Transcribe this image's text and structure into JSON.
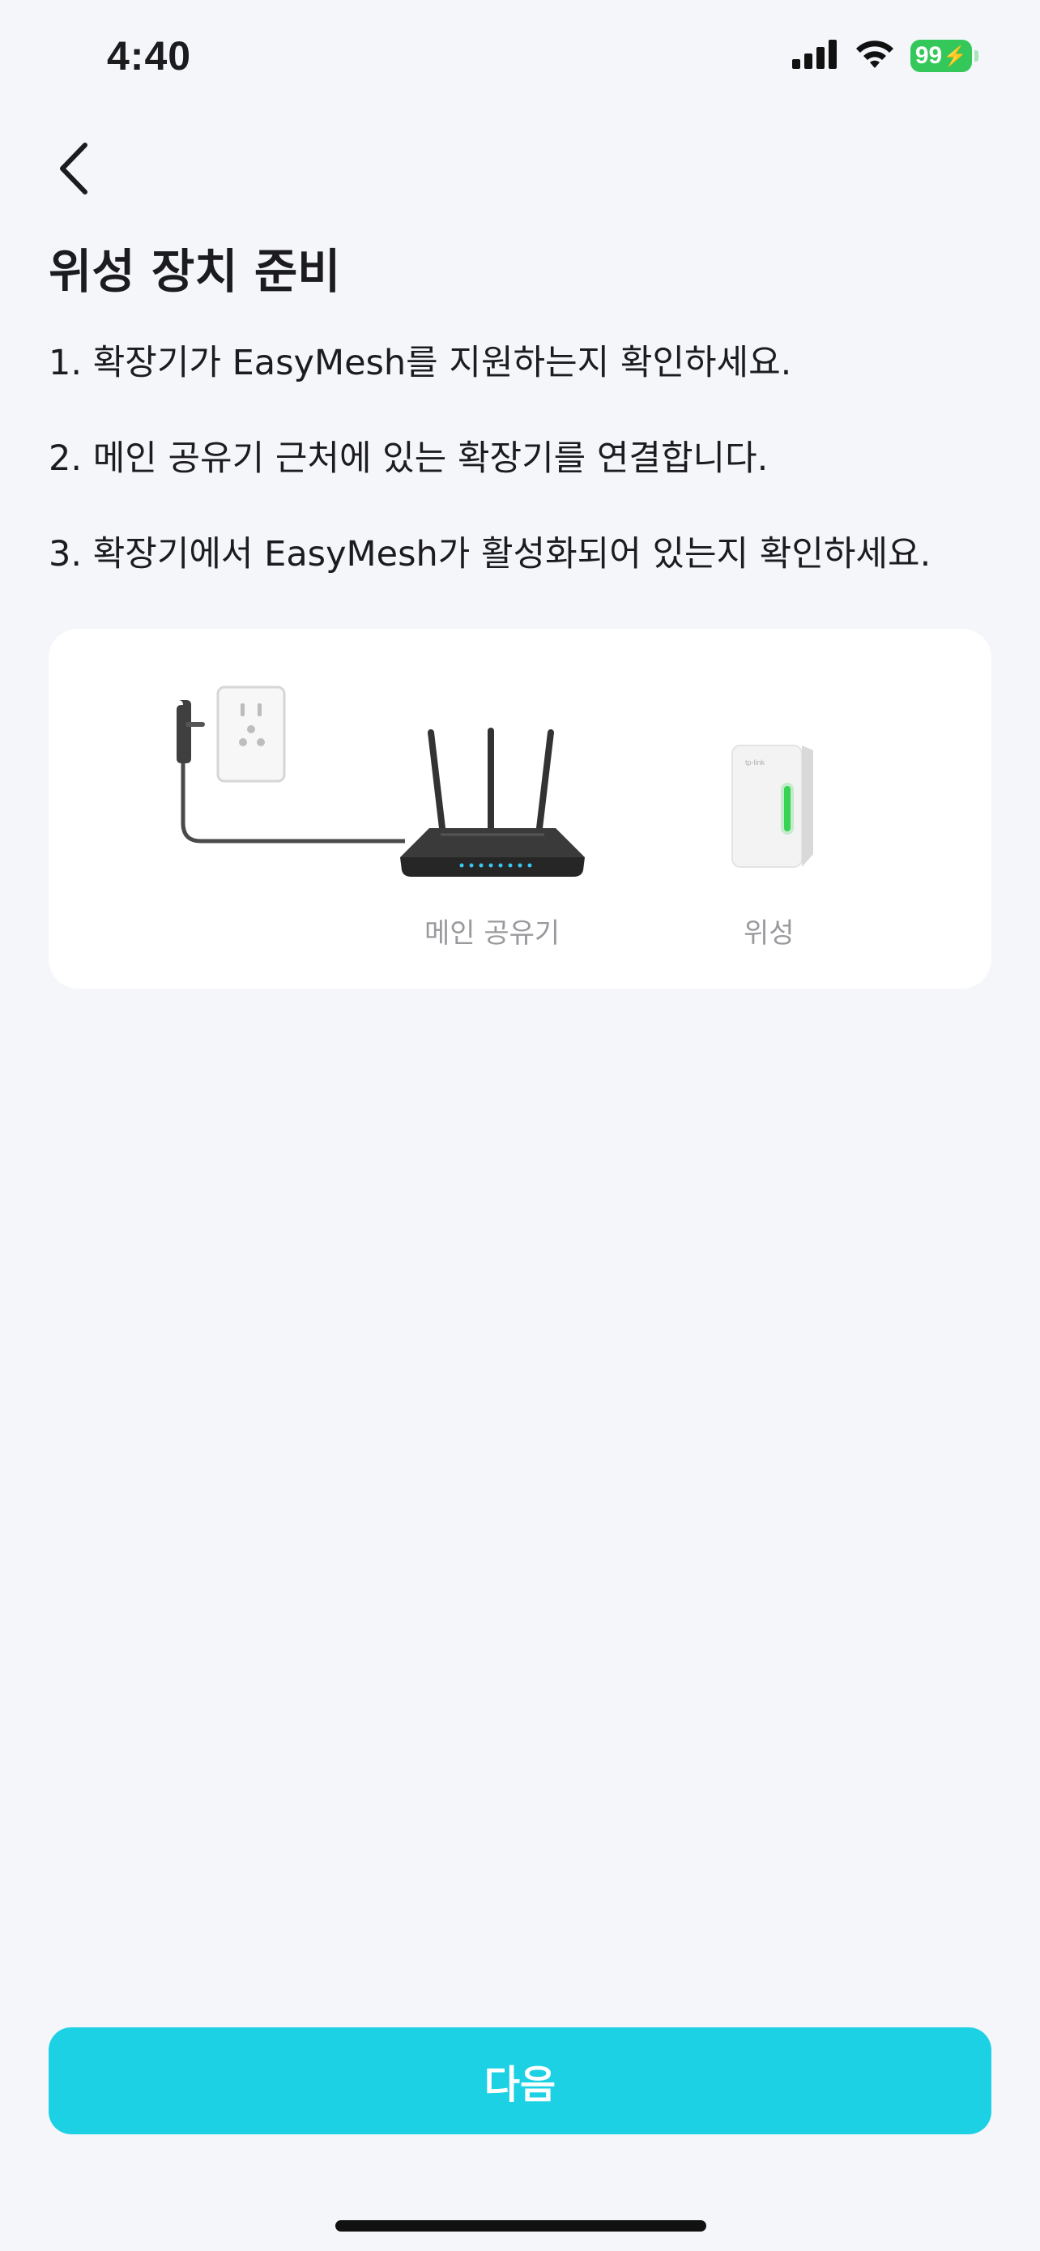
{
  "status_bar": {
    "time": "4:40",
    "battery": "99",
    "icons": [
      "cellular-signal-icon",
      "wifi-icon",
      "battery-charging-icon"
    ]
  },
  "header": {
    "back_icon": "chevron-left-icon",
    "title": "위성 장치 준비"
  },
  "steps": [
    "1. 확장기가 EasyMesh를 지원하는지 확인하세요.",
    "2. 메인 공유기 근처에 있는 확장기를 연결합니다.",
    "3. 확장기에서 EasyMesh가 활성화되어 있는지 확인하세요."
  ],
  "illustration": {
    "main_router_label": "메인 공유기",
    "satellite_label": "위성"
  },
  "footer": {
    "next_label": "다음"
  },
  "colors": {
    "background": "#f5f6fa",
    "accent": "#1dd1e4",
    "battery": "#34c759",
    "satellite_led": "#39d353"
  }
}
